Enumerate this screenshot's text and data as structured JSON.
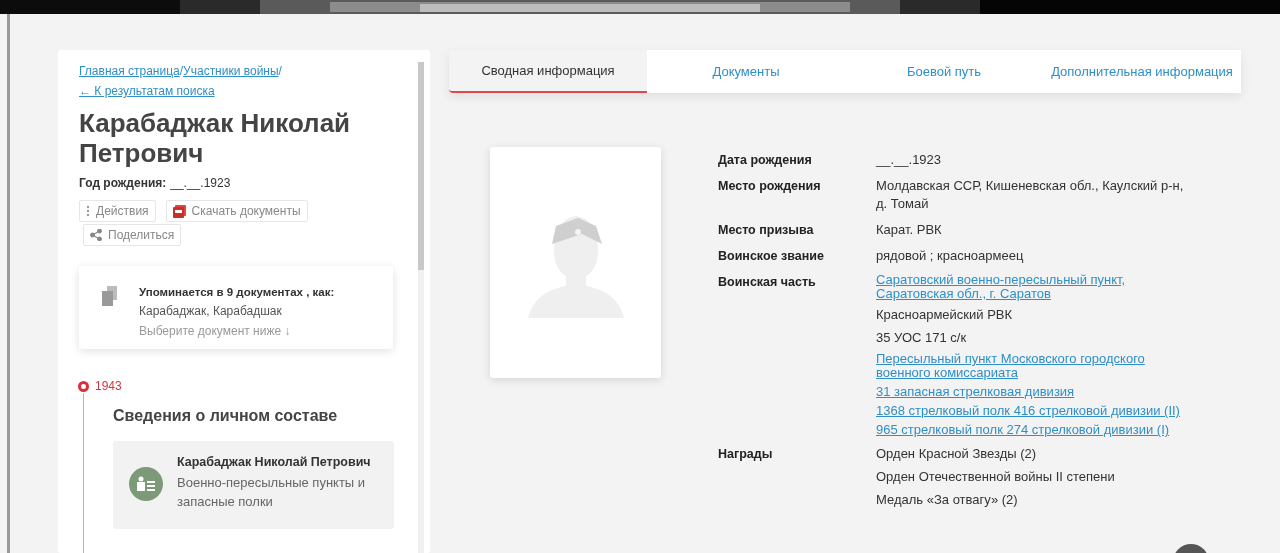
{
  "breadcrumbs": [
    {
      "label": "Главная страница",
      "separator": "/"
    },
    {
      "label": "Участники войны",
      "separator": "/"
    }
  ],
  "back_link": "← К результатам поиска",
  "person": {
    "name": "Карабаджак Николай Петрович",
    "birth_year_label": "Год рождения:",
    "birth_year": "__.__.1923"
  },
  "actions": [
    {
      "kind": "menu",
      "label": "Действия"
    },
    {
      "kind": "download",
      "label": "Скачать документы"
    },
    {
      "kind": "share",
      "label": "Поделиться"
    }
  ],
  "mentions": {
    "title": "Упоминается в 9 документах , как:",
    "names": "Карабаджак, Карабадшак",
    "hint": "Выберите документ ниже ↓"
  },
  "timeline": [
    {
      "year": "1943",
      "title": "Сведения о личном составе",
      "cards": [
        {
          "name": "Карабаджак Николай Петрович",
          "description": "Военно-пересыльные пункты и запасные полки"
        }
      ]
    }
  ],
  "tabs": [
    {
      "label": "Сводная информация",
      "selected": true
    },
    {
      "label": "Документы",
      "selected": false
    },
    {
      "label": "Боевой путь",
      "selected": false
    },
    {
      "label": "Дополнительная информация",
      "selected": false
    }
  ],
  "details": [
    {
      "label": "Дата рождения",
      "values": [
        {
          "kind": "text",
          "text": "__.__.1923"
        }
      ]
    },
    {
      "label": "Место рождения",
      "values": [
        {
          "kind": "text",
          "text": "Молдавская ССР, Кишеневская обл., Каулский р-н, д. Томай"
        }
      ]
    },
    {
      "label": "Место призыва",
      "values": [
        {
          "kind": "text",
          "text": "Карат. РВК"
        }
      ]
    },
    {
      "label": "Воинское звание",
      "values": [
        {
          "kind": "text",
          "text": "рядовой ; красноармеец"
        }
      ]
    },
    {
      "label": "Воинская часть",
      "values": [
        {
          "kind": "link",
          "text": "Саратовский военно-пересыльный пункт, Саратовская обл., г. Саратов"
        },
        {
          "kind": "text",
          "text": "Красноармейский РВК"
        },
        {
          "kind": "text",
          "text": "35 УОС 171 с/к"
        },
        {
          "kind": "link",
          "text": "Пересыльный пункт Московского городского военного комиссариата"
        },
        {
          "kind": "link",
          "text": "31 запасная стрелковая дивизия"
        },
        {
          "kind": "link",
          "text": "1368 стрелковый полк 416 стрелковой дивизии (II)"
        },
        {
          "kind": "link",
          "text": "965 стрелковый полк 274 стрелковой дивизии (I)"
        }
      ]
    },
    {
      "label": "Награды",
      "values": [
        {
          "kind": "text",
          "text": "Орден Красной Звезды (2)"
        },
        {
          "kind": "text",
          "text": "Орден Отечественной войны II степени"
        },
        {
          "kind": "text",
          "text": "Медаль «За отвагу» (2)"
        }
      ]
    }
  ]
}
